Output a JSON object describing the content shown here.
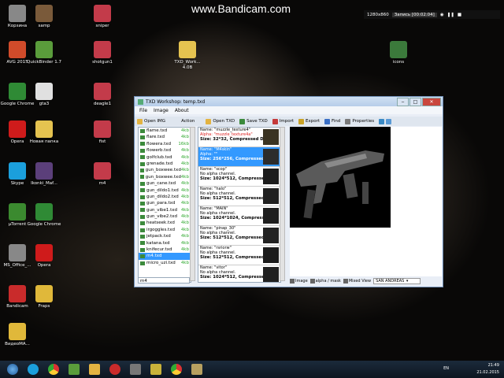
{
  "watermark": "www.Bandicam.com",
  "recorder": {
    "resolution": "1280x860",
    "status": "Запись [00:02:04]"
  },
  "desktop_icons": [
    {
      "id": "korzina",
      "label": "Корзина",
      "color": "#888888"
    },
    {
      "id": "samp",
      "label": "samp",
      "color": "#7a5a3a"
    },
    {
      "id": "sniper",
      "label": "sniper",
      "color": "#c33b4a"
    },
    {
      "id": "avg",
      "label": "AVG 2015",
      "color": "#d14b2a"
    },
    {
      "id": "quickbinder",
      "label": "QuickBinder 1.7",
      "color": "#5a9c3b"
    },
    {
      "id": "shotgun1",
      "label": "shotgun1",
      "color": "#c33b4a"
    },
    {
      "id": "txd",
      "label": "TXD_Work... 4.0B",
      "color": "#e5c350"
    },
    {
      "id": "icons",
      "label": "icons",
      "color": "#3b7a3b"
    },
    {
      "id": "chrome1",
      "label": "Google Chrome",
      "color": "#2f8a35"
    },
    {
      "id": "gta3",
      "label": "gta3",
      "color": "#e0e0e0"
    },
    {
      "id": "deagle1",
      "label": "deagle1",
      "color": "#c33b4a"
    },
    {
      "id": "opera1",
      "label": "Opera",
      "color": "#cf1b1b"
    },
    {
      "id": "newfolder",
      "label": "Новая папка",
      "color": "#e5c350"
    },
    {
      "id": "fist",
      "label": "fist",
      "color": "#c33b4a"
    },
    {
      "id": "skype",
      "label": "Skype",
      "color": "#1b9fdc"
    },
    {
      "id": "ikonki",
      "label": "Ikonki_Maf...",
      "color": "#5b3f7a"
    },
    {
      "id": "m4",
      "label": "m4",
      "color": "#c33b4a"
    },
    {
      "id": "utorrent",
      "label": "µTorrent",
      "color": "#3b8a2f"
    },
    {
      "id": "chrome2",
      "label": "Google Chrome",
      "color": "#2f8a35"
    },
    {
      "id": "msoffice",
      "label": "MS_Office_...",
      "color": "#888888"
    },
    {
      "id": "opera2",
      "label": "Opera",
      "color": "#cf1b1b"
    },
    {
      "id": "bandicam",
      "label": "Bandicam",
      "color": "#c92b2b"
    },
    {
      "id": "fraps",
      "label": "Fraps",
      "color": "#e0b83a"
    },
    {
      "id": "videoma",
      "label": "ВидеоМА...",
      "color": "#e0b83a"
    }
  ],
  "window": {
    "title": "TXD Workshop: temp.txd",
    "menu": [
      "File",
      "Image",
      "About"
    ],
    "left_toolbar": {
      "open_img": "Open IMG",
      "action": "Action"
    },
    "toolbar": [
      "Open TXD",
      "Save TXD",
      "Import",
      "Export",
      "Find",
      "Properties"
    ],
    "files": [
      {
        "name": "flame.txd",
        "size": "4kb"
      },
      {
        "name": "flare.txd",
        "size": "4kb"
      },
      {
        "name": "flowera.txd",
        "size": "16kb"
      },
      {
        "name": "flowerb.txd",
        "size": "4kb"
      },
      {
        "name": "golfclub.txd",
        "size": "4kb"
      },
      {
        "name": "grenade.txd",
        "size": "4kb"
      },
      {
        "name": "gun_boxwee.txd",
        "size": "4kb"
      },
      {
        "name": "gun_boxwee.txd",
        "size": "4kb"
      },
      {
        "name": "gun_cane.txd",
        "size": "4kb"
      },
      {
        "name": "gun_dildo1.txd",
        "size": "4kb"
      },
      {
        "name": "gun_dildo2.txd",
        "size": "4kb"
      },
      {
        "name": "gun_para.txd",
        "size": "4kb"
      },
      {
        "name": "gun_vibe1.txd",
        "size": "4kb"
      },
      {
        "name": "gun_vibe2.txd",
        "size": "4kb"
      },
      {
        "name": "heatseek.txd",
        "size": "4kb"
      },
      {
        "name": "irgoggles.txd",
        "size": "4kb"
      },
      {
        "name": "jetpack.txd",
        "size": "4kb"
      },
      {
        "name": "katana.txd",
        "size": "4kb"
      },
      {
        "name": "knifecur.txd",
        "size": "4kb"
      },
      {
        "name": "m4.txd",
        "size": "",
        "selected": true
      },
      {
        "name": "micro_uzi.txd",
        "size": "4kb"
      }
    ],
    "file_search": "m4",
    "textures": [
      {
        "name": "Name: \"muzzle_texture4\"",
        "alpha": "Alpha: \"muzzle_texture4a\"",
        "size": "Size: 32*32, Compressed DX",
        "thumb": "#3a3322"
      },
      {
        "name": "Name: \"M4skin\"",
        "alpha": "Alpha: \"\"",
        "size": "Size: 256*256, Compressed",
        "selected": true,
        "thumb": "#2c2c2c"
      },
      {
        "name": "Name: \"scop\"",
        "alpha": "No alpha channel.",
        "size": "Size: 1024*512, Compressed",
        "thumb": "#1c1c1c"
      },
      {
        "name": "Name: \"halo\"",
        "alpha": "No alpha channel.",
        "size": "Size: 512*512, Compressed",
        "thumb": "#202020"
      },
      {
        "name": "Name: \"MAIN\"",
        "alpha": "No alpha channel.",
        "size": "Size: 1024*1024, Compressed",
        "thumb": "#1e1e1e"
      },
      {
        "name": "Name: \"pinap_30\"",
        "alpha": "No alpha channel.",
        "size": "Size: 512*512, Compressed",
        "thumb": "#222222"
      },
      {
        "name": "Name: \"rsriorw\"",
        "alpha": "No alpha channel.",
        "size": "Size: 512*512, Compressed",
        "thumb": "#1b1b1b"
      },
      {
        "name": "Name: \"vitor\"",
        "alpha": "No alpha channel.",
        "size": "Size: 1024*512, Compressed",
        "thumb": "#202020"
      },
      {
        "name": "Name: \"mag\"",
        "alpha": "",
        "size": "",
        "thumb": "#202020"
      }
    ],
    "bottom": {
      "image": "Image",
      "alpha_mask": "alpha / mask",
      "mixed_view": "Mixed View",
      "game": "SAN ANDREAS"
    }
  },
  "taskbar": {
    "items": [
      "start",
      "skype",
      "chrome",
      "app-green",
      "explorer",
      "bandicam",
      "game",
      "image",
      "chrome2",
      "gta"
    ],
    "lang": "EN",
    "time": "21:49",
    "date": "21.02.2015"
  }
}
